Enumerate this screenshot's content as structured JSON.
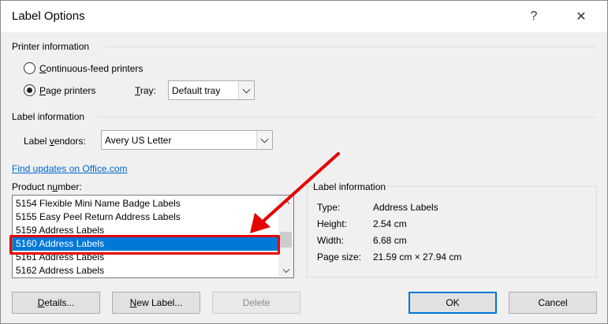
{
  "dialog": {
    "title": "Label Options",
    "help_glyph": "?",
    "close_glyph": "✕"
  },
  "printer_info": {
    "heading": "Printer information",
    "continuous_feed": {
      "pre": "",
      "key": "C",
      "post": "ontinuous-feed printers",
      "selected": false
    },
    "page_printers": {
      "pre": "",
      "key": "P",
      "post": "age printers",
      "selected": true
    },
    "tray": {
      "key": "T",
      "post": "ray:",
      "value": "Default tray"
    }
  },
  "label_info": {
    "heading": "Label information",
    "vendors": {
      "pre": "Label ",
      "key": "v",
      "post": "endors:",
      "value": "Avery US Letter"
    }
  },
  "link": {
    "text": "Find updates on Office.com"
  },
  "product_number": {
    "pre": "Product n",
    "key": "u",
    "post": "mber:",
    "items": [
      "5154 Flexible Mini Name Badge Labels",
      "5155 Easy Peel Return Address Labels",
      "5159 Address Labels",
      "5160 Address Labels",
      "5161 Address Labels",
      "5162 Address Labels"
    ],
    "selected_index": 3
  },
  "label_details": {
    "heading": "Label information",
    "rows": [
      {
        "key": "Type:",
        "value": "Address Labels"
      },
      {
        "key": "Height:",
        "value": "2.54 cm"
      },
      {
        "key": "Width:",
        "value": "6.68 cm"
      },
      {
        "key": "Page size:",
        "value": "21.59 cm × 27.94 cm"
      }
    ]
  },
  "buttons": {
    "details": {
      "key": "D",
      "post": "etails..."
    },
    "new_label": {
      "key": "N",
      "post": "ew Label..."
    },
    "delete": "Delete",
    "ok": "OK",
    "cancel": "Cancel"
  }
}
